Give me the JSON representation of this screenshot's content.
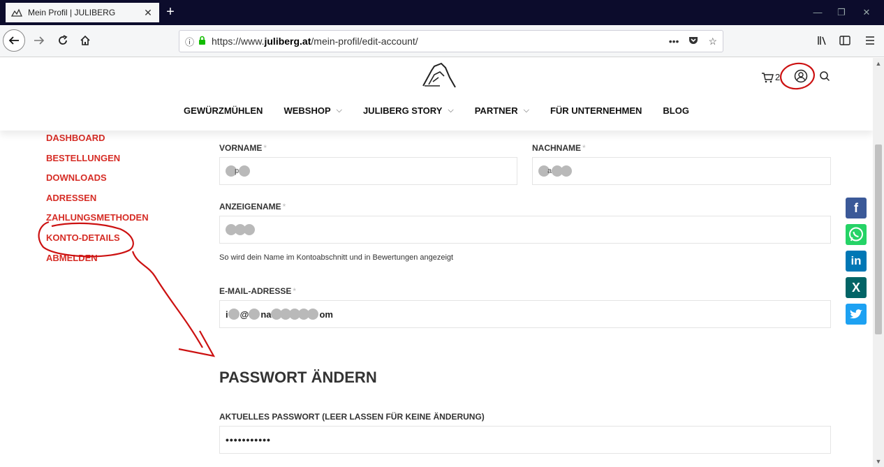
{
  "browser": {
    "tab_title": "Mein Profil | JULIBERG",
    "url_prefix": "https://www.",
    "url_domain": "juliberg.at",
    "url_path": "/mein-profil/edit-account/"
  },
  "header": {
    "cart_count": "2"
  },
  "nav": {
    "items": [
      {
        "label": "GEWÜRZMÜHLEN",
        "chevron": false
      },
      {
        "label": "WEBSHOP",
        "chevron": true
      },
      {
        "label": "JULIBERG STORY",
        "chevron": true
      },
      {
        "label": "PARTNER",
        "chevron": true
      },
      {
        "label": "FÜR UNTERNEHMEN",
        "chevron": false
      },
      {
        "label": "BLOG",
        "chevron": false
      }
    ]
  },
  "sidebar": {
    "items": [
      "DASHBOARD",
      "BESTELLUNGEN",
      "DOWNLOADS",
      "ADRESSEN",
      "ZAHLUNGSMETHODEN",
      "KONTO-DETAILS",
      "ABMELDEN"
    ]
  },
  "form": {
    "first_name_label": "VORNAME",
    "last_name_label": "NACHNAME",
    "display_name_label": "ANZEIGENAME",
    "display_name_hint": "So wird dein Name im Kontoabschnitt und in Bewertungen angezeigt",
    "email_label": "E-MAIL-ADRESSE",
    "email_visible_start": "i",
    "email_visible_at": "@",
    "email_visible_mid": "na",
    "email_visible_end": "om",
    "first_name_visible": "p",
    "last_name_visible": "a",
    "required_mark": "*",
    "password_section_title": "PASSWORT ÄNDERN",
    "current_password_label": "AKTUELLES PASSWORT (LEER LASSEN FÜR KEINE ÄNDERUNG)",
    "current_password_value": "•••••••••••"
  },
  "share": {
    "facebook": "f",
    "linkedin": "in",
    "xing": "X"
  },
  "colors": {
    "accent_red": "#d62d26",
    "facebook": "#3b5998",
    "whatsapp": "#25d366",
    "linkedin": "#0077b5",
    "xing": "#026466",
    "twitter": "#1da1f2"
  }
}
